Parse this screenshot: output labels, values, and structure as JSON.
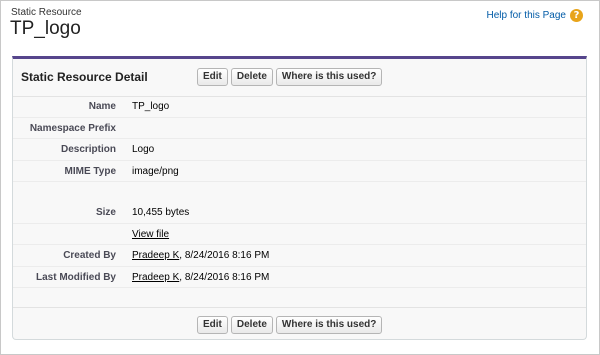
{
  "page": {
    "subtitle": "Static Resource",
    "title": "TP_logo",
    "help_link": "Help for this Page",
    "help_icon": "question-icon"
  },
  "panel": {
    "title": "Static Resource Detail",
    "buttons": {
      "edit": "Edit",
      "delete": "Delete",
      "where_used": "Where is this used?"
    }
  },
  "fields": {
    "name": {
      "label": "Name",
      "value": "TP_logo"
    },
    "namespace": {
      "label": "Namespace Prefix",
      "value": ""
    },
    "description": {
      "label": "Description",
      "value": "Logo"
    },
    "mime": {
      "label": "MIME Type",
      "value": "image/png"
    },
    "size": {
      "label": "Size",
      "value": "10,455 bytes"
    },
    "view_file": {
      "link": "View file"
    },
    "created_by": {
      "label": "Created By",
      "user": "Pradeep K",
      "date": ", 8/24/2016 8:16 PM"
    },
    "last_modified_by": {
      "label": "Last Modified By",
      "user": "Pradeep K",
      "date": ", 8/24/2016 8:16 PM"
    }
  },
  "colors": {
    "accent": "#56458c",
    "help": "#e8a41a",
    "link": "#015ba7"
  }
}
